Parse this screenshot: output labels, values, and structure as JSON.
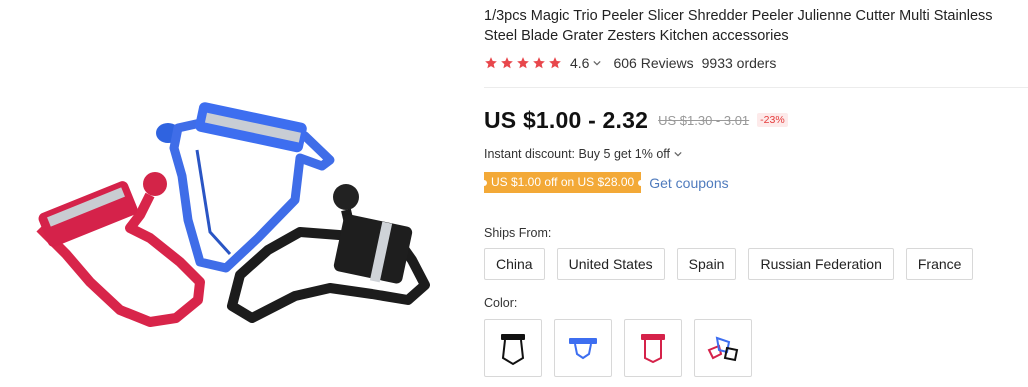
{
  "product": {
    "title": "1/3pcs Magic Trio Peeler Slicer Shredder Peeler Julienne Cutter Multi Stainless Steel Blade Grater Zesters Kitchen accessories",
    "rating_value": "4.6",
    "reviews": "606 Reviews",
    "orders": "9933 orders",
    "star_color": "#e8474c",
    "star_count": 5
  },
  "price": {
    "current": "US $1.00 - 2.32",
    "original": "US $1.30 - 3.01",
    "discount": "-23%"
  },
  "promo": {
    "instant_discount": "Instant discount: Buy 5 get 1% off",
    "coupon": "US $1.00 off on US $28.00",
    "get_coupons": "Get coupons",
    "coupon_color": "#f3a937",
    "link_color": "#4f7bbd"
  },
  "shipping": {
    "label": "Ships From:",
    "options": [
      "China",
      "United States",
      "Spain",
      "Russian Federation",
      "France"
    ]
  },
  "color": {
    "label": "Color:",
    "options": [
      "black",
      "blue",
      "red",
      "trio"
    ]
  }
}
